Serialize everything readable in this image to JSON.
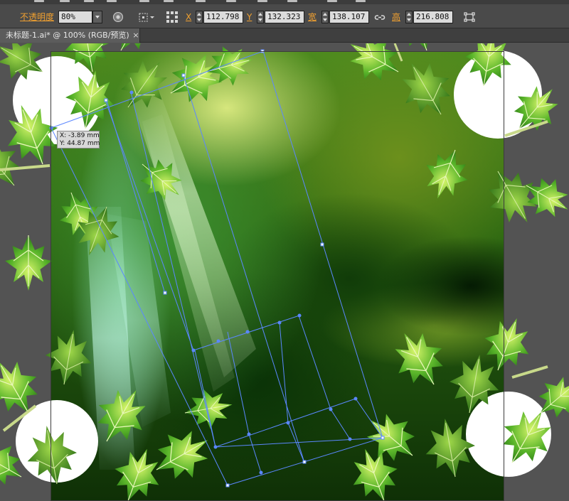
{
  "control_bar": {
    "opacity_label": "不透明度",
    "opacity_value": "80%",
    "x_label": "X",
    "x_value": "112.798",
    "y_label": "Y",
    "y_value": "132.323",
    "width_label": "宽",
    "width_value": "138.107",
    "height_label": "高",
    "height_value": "216.808",
    "accent_color": "#f0a030",
    "icons": [
      "recolor-artwork-icon",
      "transform-reference-point-icon",
      "align-icon",
      "constrain-proportions-icon",
      "transform-icon"
    ]
  },
  "document_tab": {
    "title": "未标题-1.ai* @ 100% (RGB/预览)",
    "close": "×"
  },
  "canvas": {
    "coordinate_tooltip": {
      "x": "X: -3.89 mm",
      "y": "Y: 44.87 mm"
    },
    "selection_color": "#4a7bff"
  }
}
